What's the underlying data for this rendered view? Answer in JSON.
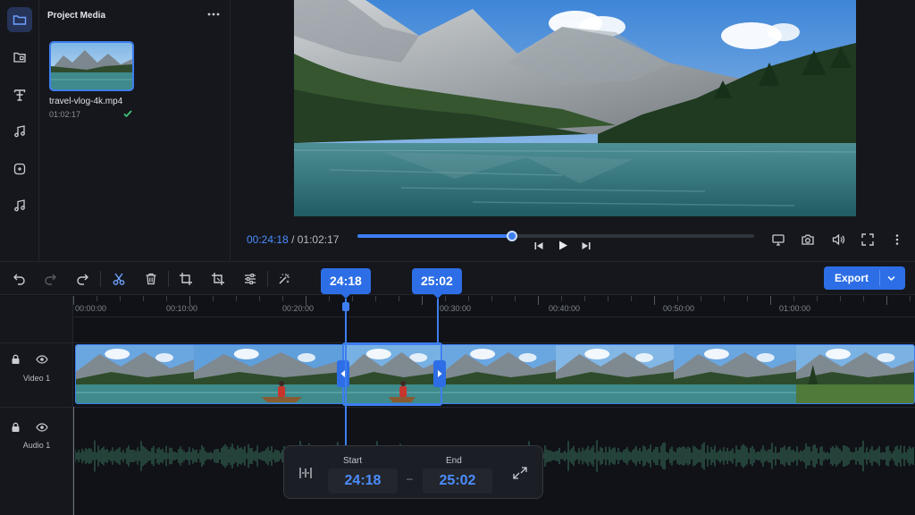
{
  "media_panel": {
    "title": "Project Media",
    "file": {
      "name": "travel-vlog-4k.mp4",
      "duration": "01:02:17",
      "status": "imported"
    }
  },
  "rail": {
    "items": [
      "media-icon",
      "templates-icon",
      "text-icon",
      "music-icon",
      "stickers-icon",
      "audio-icon"
    ],
    "active": "media-icon"
  },
  "viewer": {
    "current_time": "00:24:18",
    "separator": "/",
    "total_time": "01:02:17",
    "progress": 0.39
  },
  "toolbar": {
    "tools": [
      "undo-icon",
      "redo-icon",
      "forward-icon",
      "split-icon",
      "delete-icon",
      "crop-icon",
      "crop-alt-icon",
      "adjust-icon",
      "magic-icon"
    ],
    "export_label": "Export"
  },
  "timeline": {
    "ruler": [
      "00:00:00",
      "00:10:00",
      "00:20:00",
      "00:30:00",
      "00:40:00",
      "00:50:00",
      "01:00:00"
    ],
    "start_badge": "24:18",
    "end_badge": "25:02",
    "tracks": [
      {
        "name": "Video 1",
        "locked": true,
        "visible": true
      },
      {
        "name": "Audio 1",
        "locked": true,
        "visible": true
      }
    ]
  },
  "trim": {
    "start_label": "Start",
    "start_value": "24:18",
    "dash": "–",
    "end_label": "End",
    "end_value": "25:02"
  },
  "colors": {
    "accent": "#2d6ee6",
    "background": "#101217",
    "panel": "#15171c",
    "waveform": "#2f5c4e"
  }
}
